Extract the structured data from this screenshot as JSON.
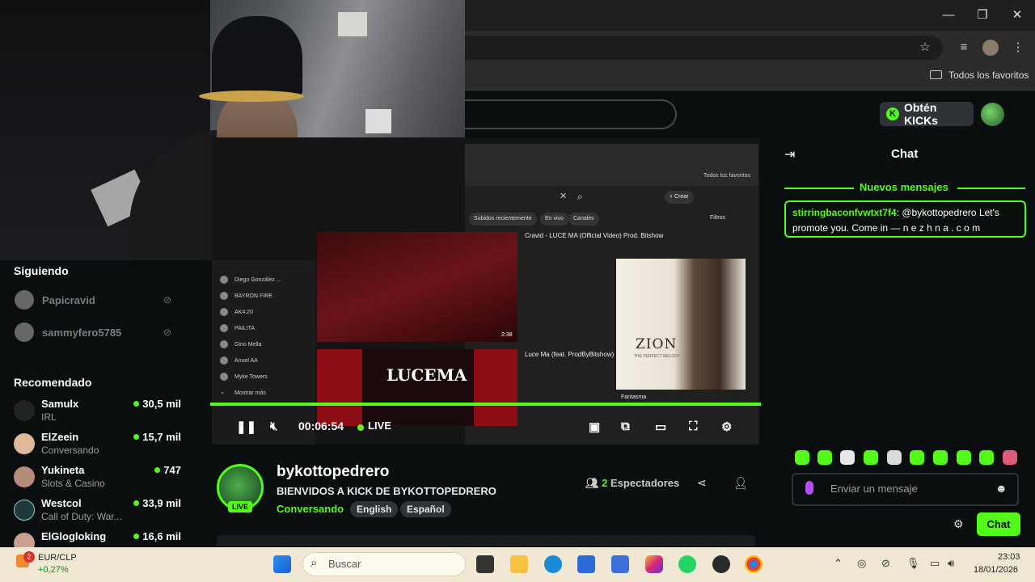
{
  "browser": {
    "window_controls": {
      "minimize": "—",
      "maximize": "❐",
      "close": "✕"
    },
    "bookmarks_folder": "Todos los favoritos"
  },
  "header": {
    "kicks_button": "Obtén KICKs",
    "kicks_icon": "K"
  },
  "sidebar": {
    "following_title": "Siguiendo",
    "following": [
      {
        "name": "Papicravid"
      },
      {
        "name": "sammyfero5785"
      }
    ],
    "recommended_title": "Recomendado",
    "recommended": [
      {
        "name": "Samulx",
        "category": "IRL",
        "viewers": "30,5 mil"
      },
      {
        "name": "ElZeein",
        "category": "Conversando",
        "viewers": "15,7 mil"
      },
      {
        "name": "Yukineta",
        "category": "Slots & Casino",
        "viewers": "747"
      },
      {
        "name": "Westcol",
        "category": "Call of Duty: War...",
        "viewers": "33,9 mil"
      },
      {
        "name": "ElGlogloking",
        "category": "",
        "viewers": "16,6 mil"
      }
    ]
  },
  "shared_screen": {
    "chips": [
      "Subidos recientemente",
      "En vivo",
      "Canales"
    ],
    "filters": "Filtros",
    "create": "+ Crear",
    "bookmarks": "Todos los favoritos",
    "side_items": [
      "Diego González ...",
      "BAYRON FIRE",
      "AK4:20",
      "PAILITA",
      "Gino Mella",
      "Anuel AA",
      "Myke Towers",
      "Mostrar más"
    ],
    "video1_title": "Cravid - LUCE MA (Official Video) Prod. Bitshow",
    "video2_title": "Luce Ma (feat. ProdByBitshow)",
    "album_title": "ZION",
    "album_sub": "THE PERFECT MELODY",
    "song_label": "Fantasma",
    "thumb_text": "LUCEMA",
    "duration": "2:38"
  },
  "player": {
    "time": "00:06:54",
    "live_label": "LIVE"
  },
  "stream": {
    "channel": "bykottopedrero",
    "title": "BIENVIDOS A KICK DE BYKOTTOPEDRERO",
    "category": "Conversando",
    "tags": [
      "English",
      "Español"
    ],
    "viewers_count": "2",
    "viewers_label": "Espectadores",
    "live_badge": "LIVE"
  },
  "chat": {
    "title": "Chat",
    "new_messages": "Nuevos mensajes",
    "message_user": "stirringbaconfvwtxt7f4",
    "message_text": ": @bykottopedrero Let's promote you. Come  in — n e z h n a . c o m",
    "input_placeholder": "Enviar un mensaje",
    "send_button": "Chat"
  },
  "taskbar": {
    "ticker_badge": "2",
    "ticker_name": "EUR/CLP",
    "ticker_change": "+0,27%",
    "search_placeholder": "Buscar",
    "time": "23:03",
    "date": "18/01/2026"
  },
  "colors": {
    "kick_green": "#53fc18",
    "background": "#0b0e0f"
  }
}
